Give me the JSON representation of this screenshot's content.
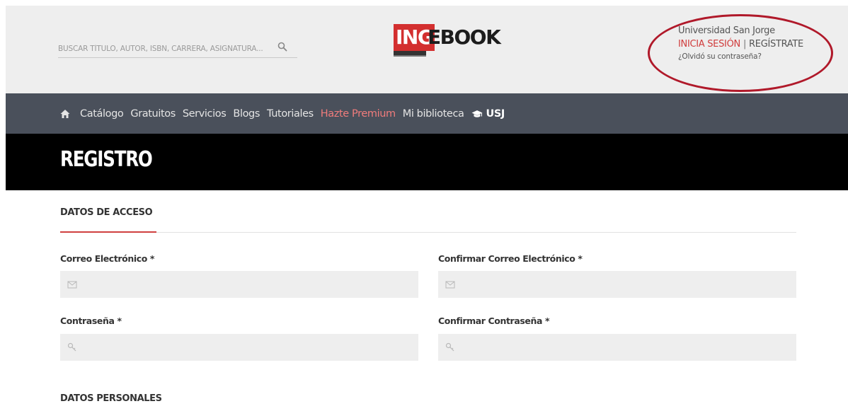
{
  "header": {
    "search": {
      "placeholder": "BUSCAR TÍTULO, AUTOR, ISBN, CARRERA, ASIGNATURA...",
      "icon": "search-icon"
    },
    "logo": {
      "part1": "ING",
      "part2": "EBOOK",
      "colors": {
        "red": "#d32f2f",
        "dark": "#1c1c1c"
      }
    },
    "account": {
      "university": "Universidad San Jorge",
      "login_label": "INICIA SESIÓN",
      "separator": "|",
      "register_label": "REGÍSTRATE",
      "forgot_label": "¿Olvidó su contraseña?"
    },
    "annotation_color": "#b0192a"
  },
  "nav": {
    "home_icon": "home-icon",
    "items": [
      {
        "label": "Catálogo"
      },
      {
        "label": "Gratuitos"
      },
      {
        "label": "Servicios"
      },
      {
        "label": "Blogs"
      },
      {
        "label": "Tutoriales"
      },
      {
        "label": "Hazte Premium",
        "highlight": true
      },
      {
        "label": "Mi biblioteca"
      }
    ],
    "usj": {
      "icon": "graduation-cap-icon",
      "label": "USJ"
    }
  },
  "page": {
    "title": "REGISTRO"
  },
  "form": {
    "access_section": {
      "title": "DATOS DE ACCESO",
      "fields": {
        "email": {
          "label": "Correo Electrónico *",
          "value": "",
          "icon": "envelope-icon"
        },
        "email_confirm": {
          "label": "Confirmar Correo Electrónico *",
          "value": "",
          "icon": "envelope-icon"
        },
        "password": {
          "label": "Contraseña *",
          "value": "",
          "icon": "key-icon"
        },
        "password_confirm": {
          "label": "Confirmar Contraseña *",
          "value": "",
          "icon": "key-icon"
        }
      }
    },
    "personal_section": {
      "title": "DATOS PERSONALES"
    }
  },
  "colors": {
    "accent": "#d0403f",
    "nav_bg": "#4a505b",
    "header_bg": "#eeeeee",
    "title_bg": "#000000",
    "field_bg": "#eeeeee"
  }
}
